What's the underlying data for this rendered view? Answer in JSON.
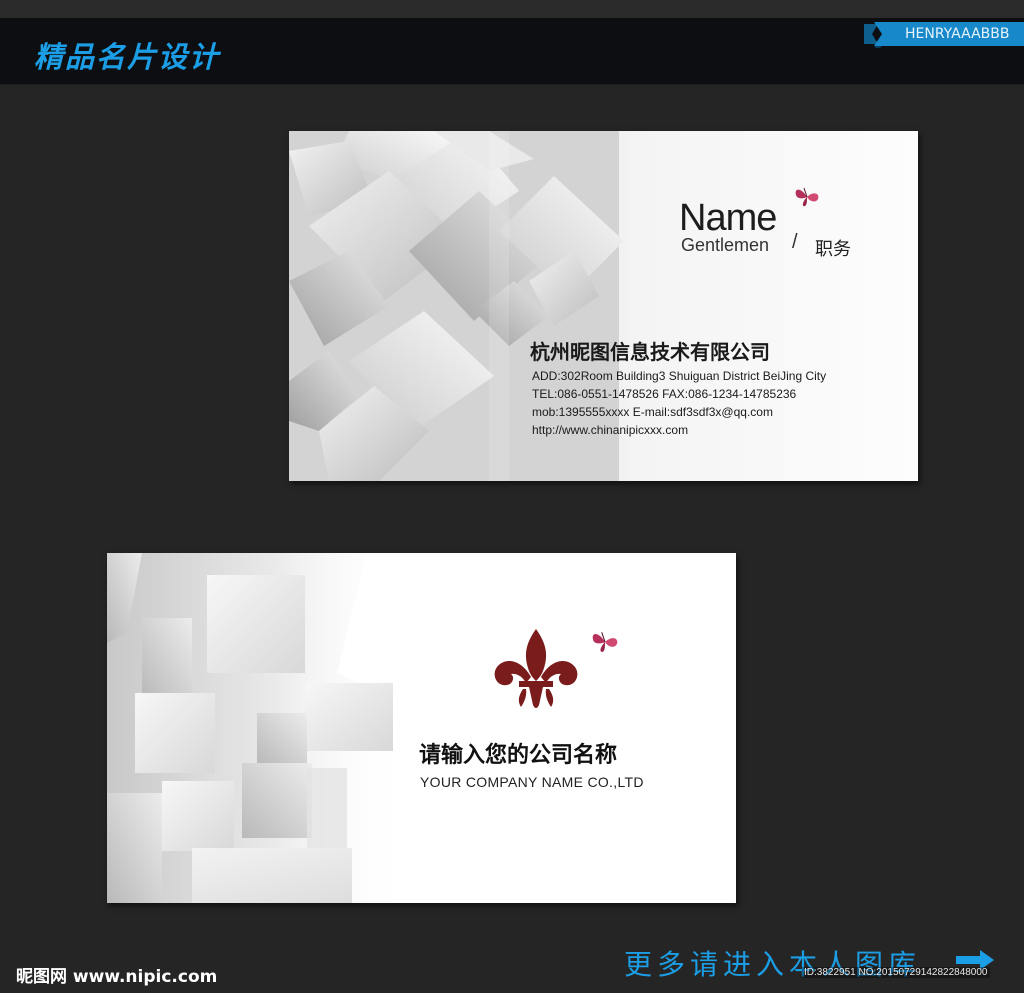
{
  "header": {
    "title": "精品名片设计",
    "author_tag": "HENRYAAABBB"
  },
  "card1": {
    "name": "Name",
    "subtitle": "Gentlemen",
    "separator": "/",
    "position": "职务",
    "company": "杭州昵图信息技术有限公司",
    "address": "ADD:302Room Building3 Shuiguan  District BeiJing City",
    "tel_fax": "TEL:086-0551-1478526   FAX:086-1234-14785236",
    "mob_email": "mob:1395555xxxx  E-mail:sdf3sdf3x@qq.com",
    "website": "http://www.chinanipicxxx.com"
  },
  "card2": {
    "company_cn": "请输入您的公司名称",
    "company_en": "YOUR COMPANY NAME CO.,LTD"
  },
  "footer": {
    "site": "昵图网 www.nipic.com",
    "more_link": "更多请进入本人图库",
    "image_id": "ID:3822951 NO:20150729142822848000"
  },
  "colors": {
    "accent_blue": "#1c9ee6",
    "logo_red": "#7a1c1c",
    "butterfly": "#b5305a"
  },
  "icons": [
    "butterfly-icon",
    "fleur-de-lis-logo",
    "arrow-right-icon"
  ]
}
